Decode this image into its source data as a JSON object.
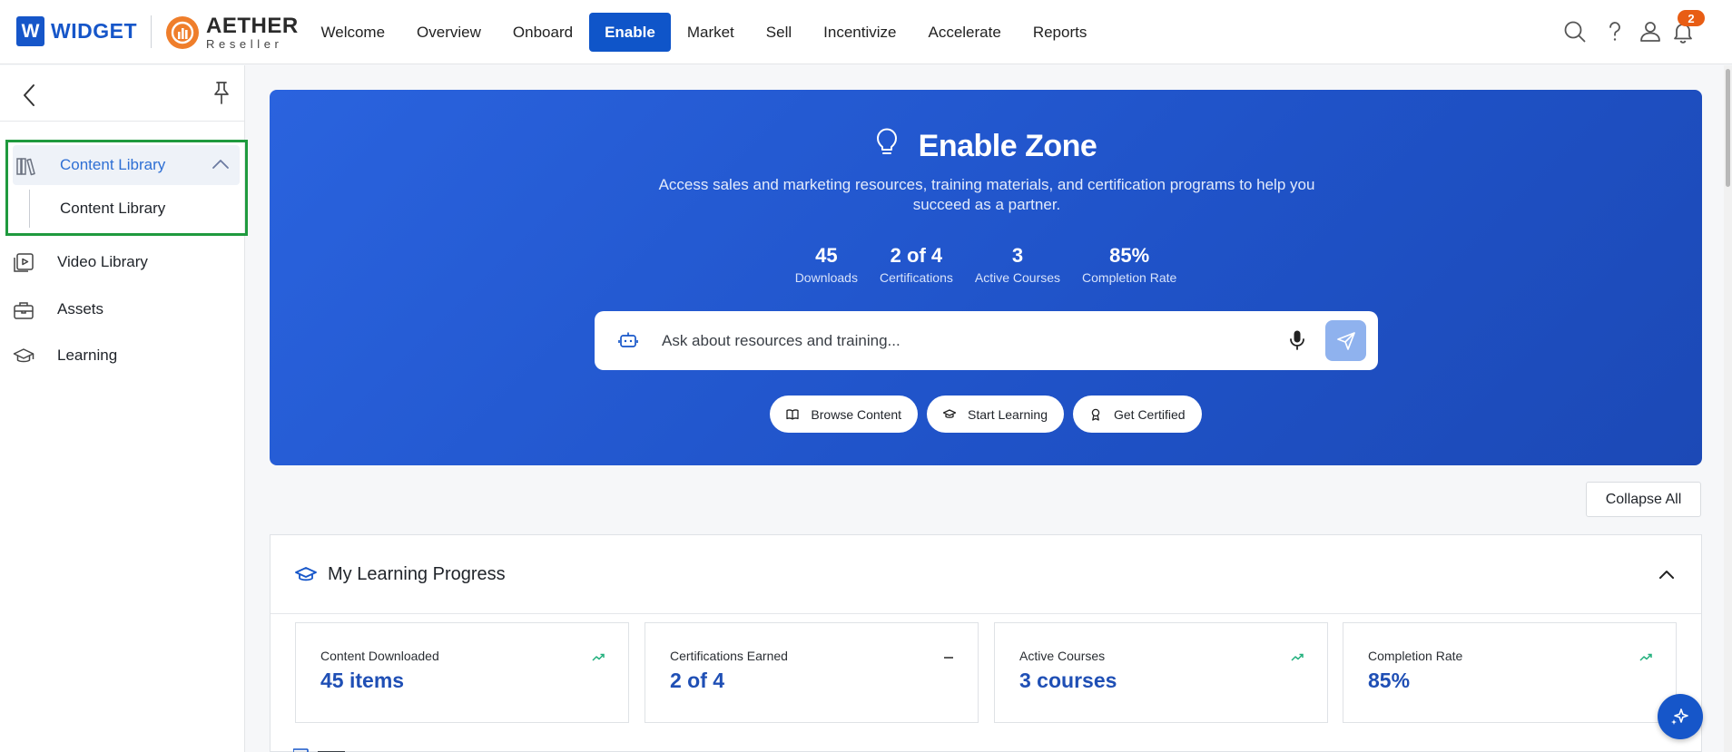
{
  "brand": {
    "widget_mark": "W",
    "widget_name": "WIDGET",
    "aether_name": "AETHER",
    "aether_sub": "Reseller"
  },
  "nav": {
    "items": [
      {
        "label": "Welcome",
        "active": false
      },
      {
        "label": "Overview",
        "active": false
      },
      {
        "label": "Onboard",
        "active": false
      },
      {
        "label": "Enable",
        "active": true
      },
      {
        "label": "Market",
        "active": false
      },
      {
        "label": "Sell",
        "active": false
      },
      {
        "label": "Incentivize",
        "active": false
      },
      {
        "label": "Accelerate",
        "active": false
      },
      {
        "label": "Reports",
        "active": false
      }
    ],
    "notification_count": "2",
    "colors": {
      "active": "#0f55c9",
      "badge": "#e85d14"
    }
  },
  "sidebar": {
    "group_label": "Content Library",
    "group_child": "Content Library",
    "items": [
      {
        "label": "Video Library",
        "icon": "video-library-icon"
      },
      {
        "label": "Assets",
        "icon": "briefcase-icon"
      },
      {
        "label": "Learning",
        "icon": "graduation-cap-icon"
      }
    ]
  },
  "hero": {
    "title": "Enable Zone",
    "description": "Access sales and marketing resources, training materials, and certification programs to help you succeed as a partner.",
    "stats": [
      {
        "value": "45",
        "label": "Downloads"
      },
      {
        "value": "2 of 4",
        "label": "Certifications"
      },
      {
        "value": "3",
        "label": "Active Courses"
      },
      {
        "value": "85%",
        "label": "Completion Rate"
      }
    ],
    "search_placeholder": "Ask about resources and training...",
    "chips": [
      {
        "label": "Browse Content",
        "icon": "book-open-icon"
      },
      {
        "label": "Start Learning",
        "icon": "graduation-cap-icon"
      },
      {
        "label": "Get Certified",
        "icon": "award-icon"
      }
    ]
  },
  "collapse_label": "Collapse All",
  "progress": {
    "title": "My Learning Progress",
    "cards": [
      {
        "label": "Content Downloaded",
        "value": "45 items",
        "trend": "up"
      },
      {
        "label": "Certifications Earned",
        "value": "2 of 4",
        "trend": "flat"
      },
      {
        "label": "Active Courses",
        "value": "3 courses",
        "trend": "up"
      },
      {
        "label": "Completion Rate",
        "value": "85%",
        "trend": "up"
      }
    ]
  }
}
